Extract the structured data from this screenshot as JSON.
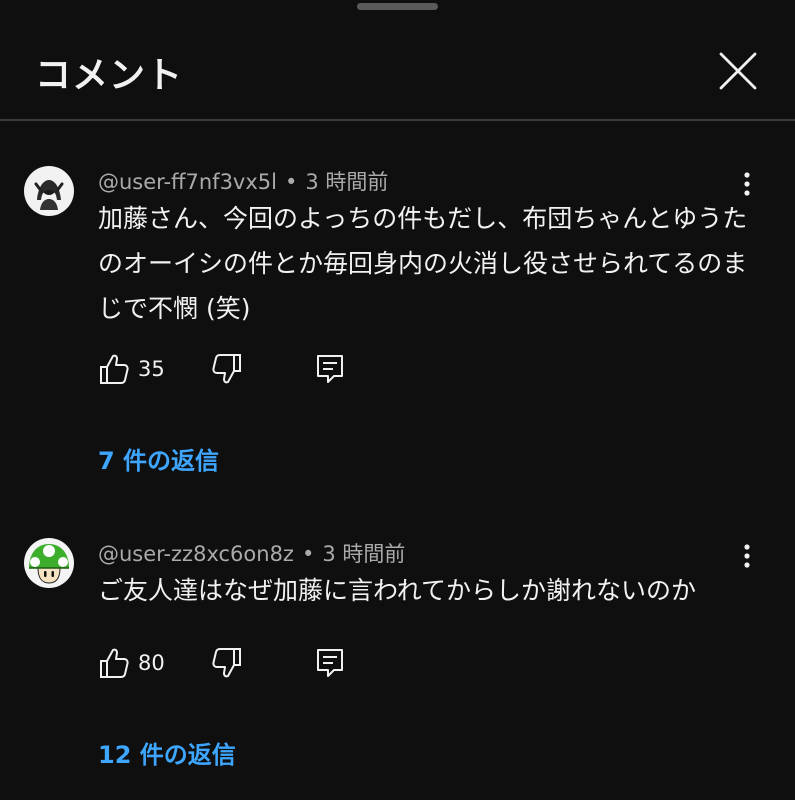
{
  "header": {
    "title": "コメント"
  },
  "comments": [
    {
      "username": "@user-ff7nf3vx5l",
      "separator": "•",
      "time": "3 時間前",
      "text": "加藤さん、今回のよっちの件もだし、布団ちゃんとゆうたのオーイシの件とか毎回身内の火消し役させられてるのまじで不憫 (笑)",
      "likes": "35",
      "replies_label": "7 件の返信"
    },
    {
      "username": "@user-zz8xc6on8z",
      "separator": "•",
      "time": "3 時間前",
      "text": "ご友人達はなぜ加藤に言われてからしか謝れないのか",
      "likes": "80",
      "replies_label": "12 件の返信"
    }
  ],
  "colors": {
    "background": "#0f0f0f",
    "text_primary": "#f1f1f1",
    "text_secondary": "#aaaaaa",
    "link": "#3ea6ff",
    "divider": "#3a3a3a"
  }
}
